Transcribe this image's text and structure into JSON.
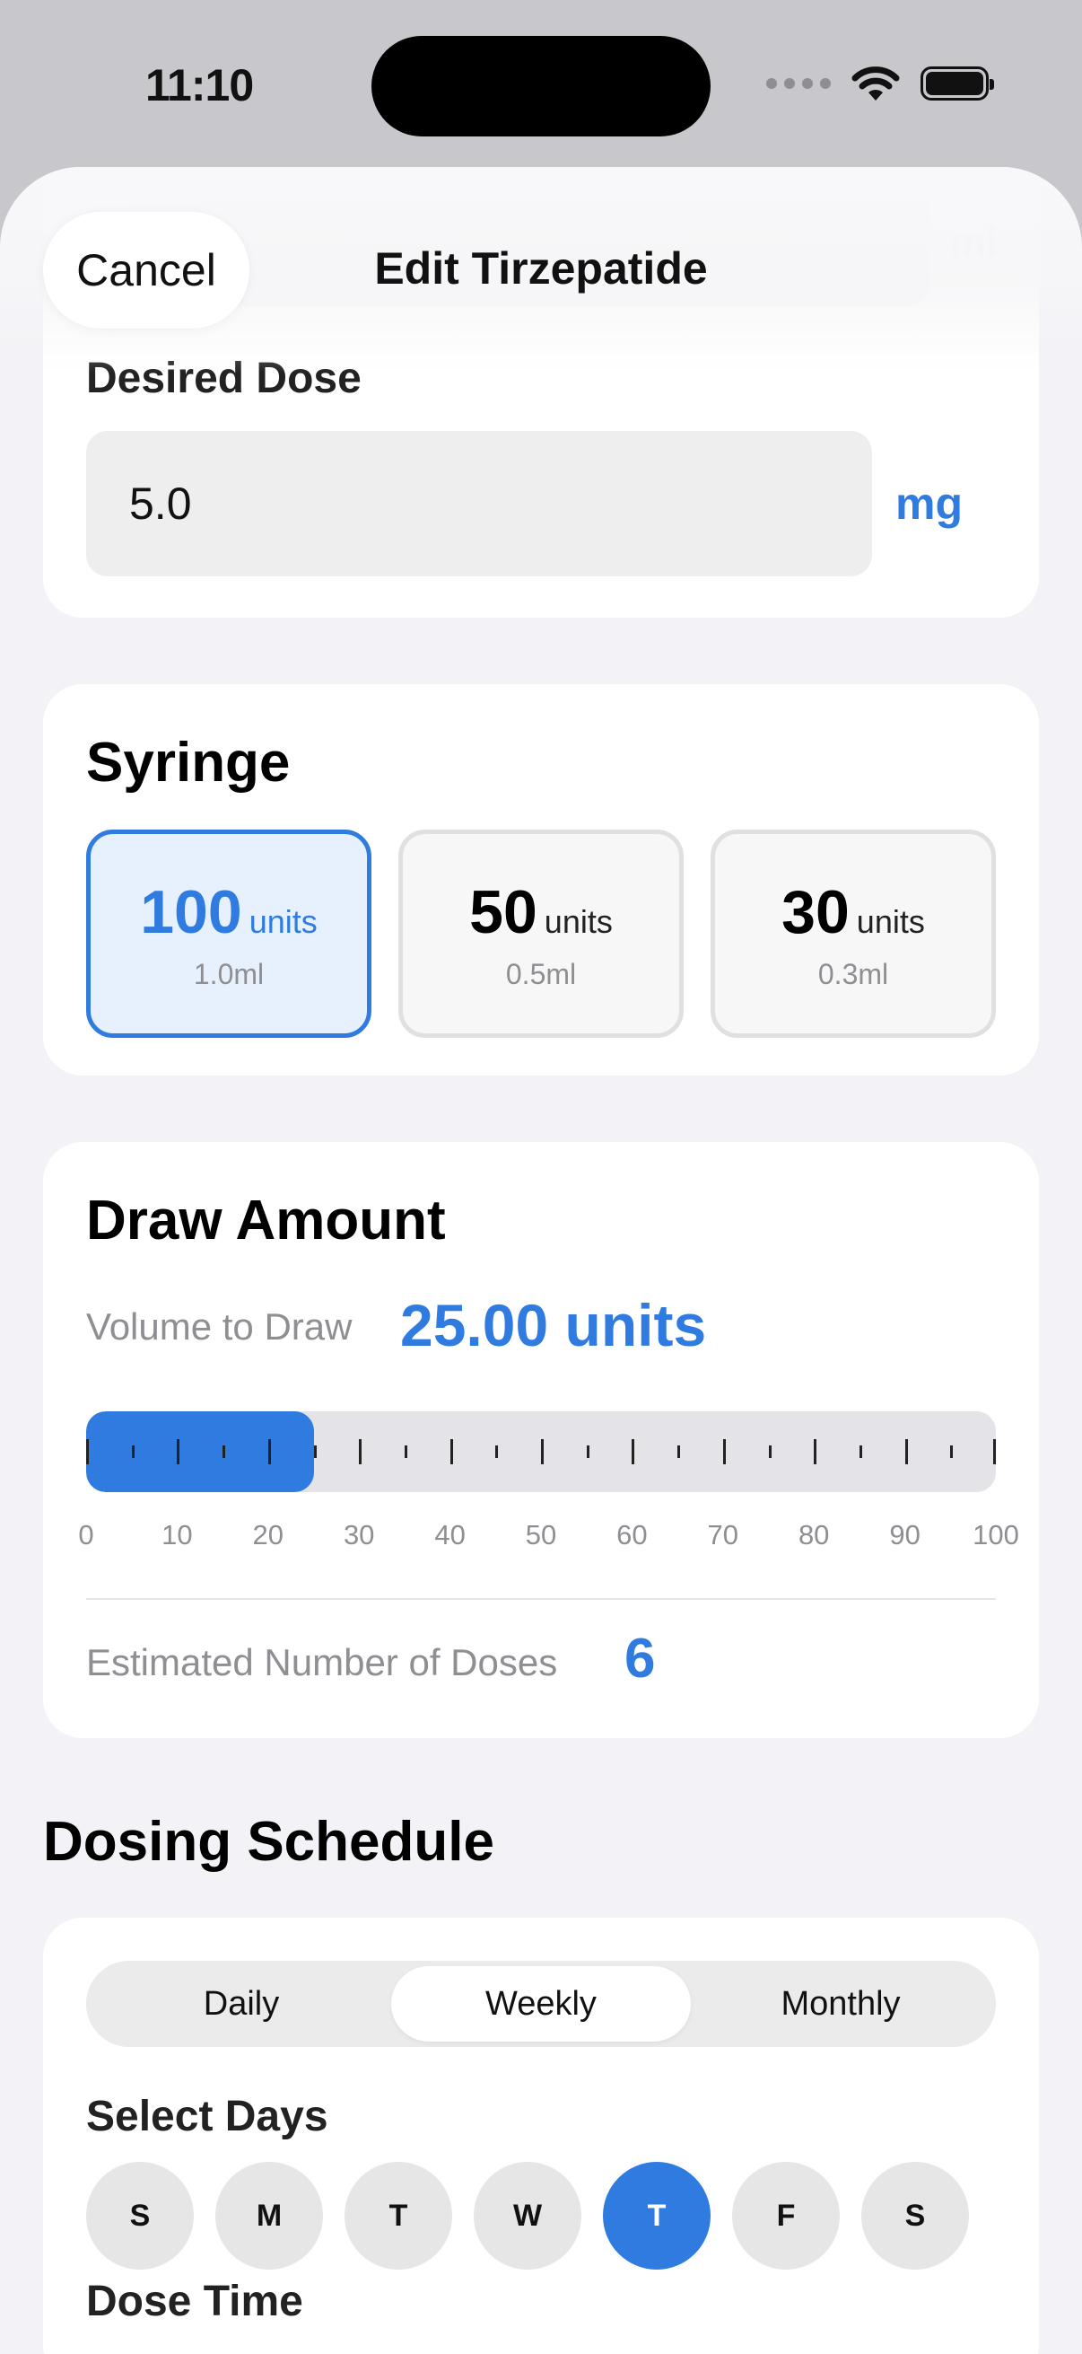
{
  "status": {
    "time": "11:10"
  },
  "header": {
    "cancel_label": "Cancel",
    "title": "Edit Tirzepatide",
    "ghost_unit": "ml"
  },
  "dose": {
    "label": "Desired Dose",
    "value": "5.0",
    "unit": "mg"
  },
  "syringe": {
    "title": "Syringe",
    "options": [
      {
        "units": "100",
        "unit_label": "units",
        "ml": "1.0ml",
        "selected": true
      },
      {
        "units": "50",
        "unit_label": "units",
        "ml": "0.5ml",
        "selected": false
      },
      {
        "units": "30",
        "unit_label": "units",
        "ml": "0.3ml",
        "selected": false
      }
    ]
  },
  "draw": {
    "title": "Draw Amount",
    "volume_label": "Volume to Draw",
    "volume_value": "25.00 units",
    "fill_fraction": 0.25,
    "scale": {
      "min": 0,
      "max": 100,
      "major_step": 10,
      "minor_step": 5
    },
    "scale_labels": [
      "0",
      "10",
      "20",
      "30",
      "40",
      "50",
      "60",
      "70",
      "80",
      "90",
      "100"
    ],
    "estimate_label": "Estimated Number of Doses",
    "estimate_value": "6"
  },
  "schedule": {
    "heading": "Dosing Schedule",
    "frequency_options": [
      "Daily",
      "Weekly",
      "Monthly"
    ],
    "selected_frequency_index": 1,
    "days_label": "Select Days",
    "days": [
      "S",
      "M",
      "T",
      "W",
      "T",
      "F",
      "S"
    ],
    "selected_day_index": 4,
    "time_label": "Dose Time"
  },
  "colors": {
    "accent": "#2f7be0",
    "background": "#f2f2f7",
    "card": "#ffffff",
    "muted": "#8e8e93"
  }
}
